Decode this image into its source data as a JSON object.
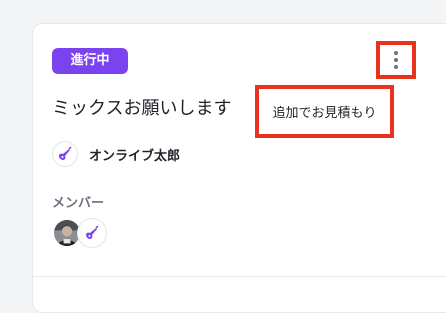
{
  "card": {
    "status_badge": "進行中",
    "title": "ミックスお願いします",
    "owner_name": "オンライブ太郎",
    "members_label": "メンバー",
    "menu": {
      "item_label": "追加でお見積もり"
    }
  },
  "icons": {
    "kebab": "more-vertical-icon",
    "owner_avatar": "guitar-icon",
    "member_photo": "user-photo",
    "member_guitar": "guitar-icon"
  },
  "colors": {
    "badge_bg": "#7b43f0",
    "highlight": "#e8341c",
    "guitar": "#7b43f0"
  }
}
